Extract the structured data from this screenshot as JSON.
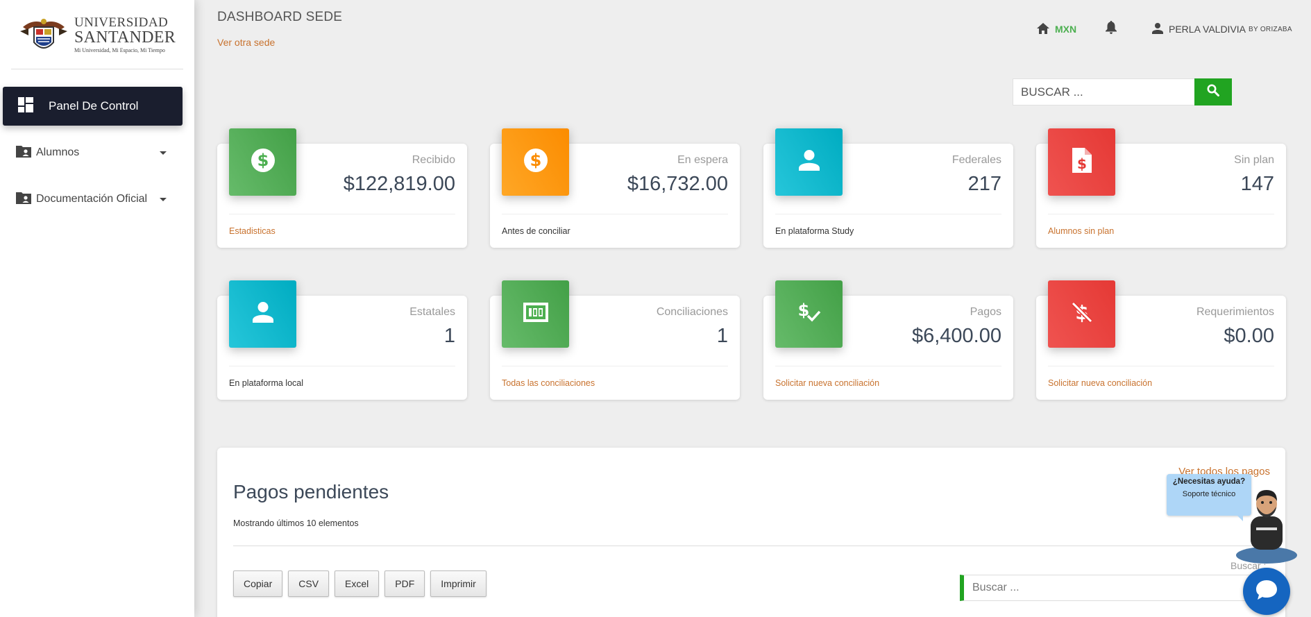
{
  "sidebar": {
    "logo": {
      "line1": "UNIVERSIDAD",
      "line2": "SANTANDER",
      "tagline": "Mi Universidad, Mi Espacio, Mi Tiempo"
    },
    "items": [
      {
        "label": "Panel De Control",
        "icon": "dashboard-icon",
        "active": true
      },
      {
        "label": "Alumnos",
        "icon": "folder-user-icon"
      },
      {
        "label": "Documentación Oficial",
        "icon": "folder-user-icon"
      }
    ]
  },
  "header": {
    "title": "DASHBOARD SEDE",
    "link": "Ver otra sede",
    "currency": "MXN",
    "user_name": "PERLA VALDIVIA",
    "user_sede": "BY ORIZABA"
  },
  "search": {
    "placeholder": "BUSCAR ..."
  },
  "cards": [
    {
      "category": "Recibido",
      "value": "$122,819.00",
      "footer": "Estadisticas",
      "footer_link": true,
      "color": "#4caf50",
      "icon": "dollar-icon"
    },
    {
      "category": "En espera",
      "value": "$16,732.00",
      "footer": "Antes de conciliar",
      "footer_link": false,
      "color": "#ff9800",
      "icon": "dollar-icon"
    },
    {
      "category": "Federales",
      "value": "217",
      "footer": "En plataforma Study",
      "footer_link": false,
      "color": "#00bcd4",
      "icon": "person-icon"
    },
    {
      "category": "Sin plan",
      "value": "147",
      "footer": "Alumnos sin plan",
      "footer_link": true,
      "color": "#f44336",
      "icon": "file-dollar-icon"
    },
    {
      "category": "Estatales",
      "value": "1",
      "footer": "En plataforma local",
      "footer_link": false,
      "color": "#00bcd4",
      "icon": "person-icon"
    },
    {
      "category": "Conciliaciones",
      "value": "1",
      "footer": "Todas las conciliaciones",
      "footer_link": true,
      "color": "#4caf50",
      "icon": "money-bill-icon"
    },
    {
      "category": "Pagos",
      "value": "$6,400.00",
      "footer": "Solicitar nueva conciliación",
      "footer_link": true,
      "color": "#4caf50",
      "icon": "price-check-icon"
    },
    {
      "category": "Requerimientos",
      "value": "$0.00",
      "footer": "Solicitar nueva conciliación",
      "footer_link": true,
      "color": "#f44336",
      "icon": "money-off-icon"
    }
  ],
  "pagos": {
    "title": "Pagos pendientes",
    "subtitle": "Mostrando últimos 10 elementos",
    "link": "Ver todos los pagos",
    "buttons": [
      "Copiar",
      "CSV",
      "Excel",
      "PDF",
      "Imprimir"
    ],
    "search_label": "Buscar :",
    "search_placeholder": "Buscar ..."
  },
  "help": {
    "question": "¿Necesitas ayuda?",
    "support": "Soporte técnico"
  },
  "colors": {
    "accent_green": "#21a421",
    "link_orange": "#c8722e",
    "sidebar_active": "#1a1e2e",
    "chat_blue": "#1565c0"
  }
}
